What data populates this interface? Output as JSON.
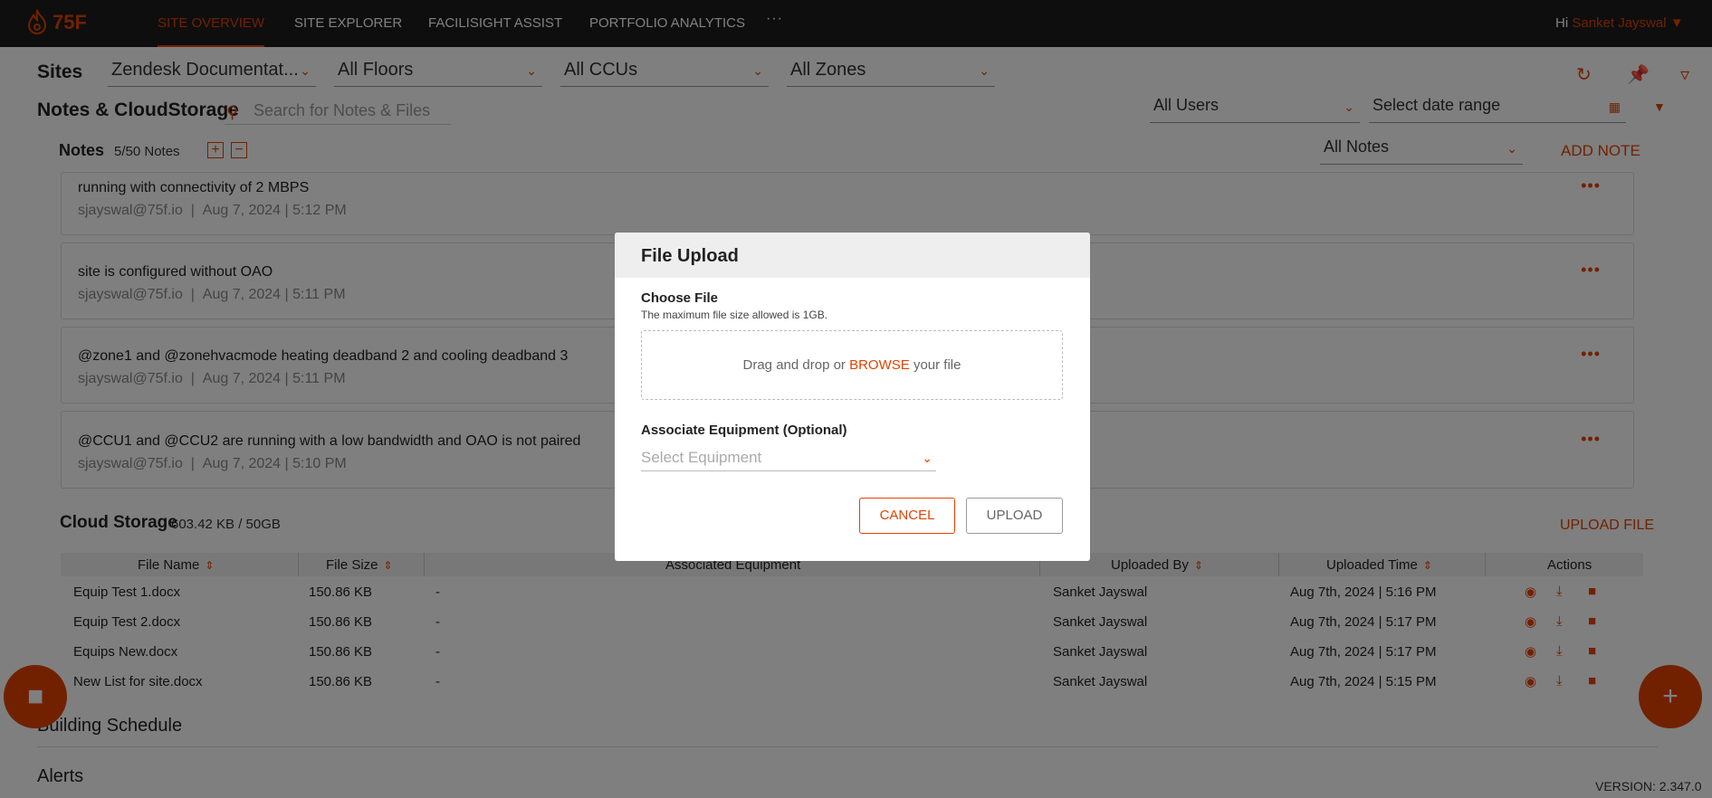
{
  "nav": {
    "brand": "75F",
    "items": [
      "SITE OVERVIEW",
      "SITE EXPLORER",
      "FACILISIGHT ASSIST",
      "PORTFOLIO ANALYTICS"
    ],
    "more": "···",
    "greeting": "Hi",
    "user_name": "Sanket Jayswal"
  },
  "filters": {
    "sites_label": "Sites",
    "site": "Zendesk Documentat...",
    "floors": "All Floors",
    "ccus": "All CCUs",
    "zones": "All Zones"
  },
  "notes_storage": {
    "title": "Notes & CloudStorage",
    "search_placeholder": "Search for Notes & Files",
    "users_filter": "All Users",
    "date_range_placeholder": "Select date range"
  },
  "notes": {
    "label": "Notes",
    "count": "5/50 Notes",
    "filter": "All Notes",
    "add_label": "ADD NOTE",
    "items": [
      {
        "text": "running with connectivity of 2 MBPS",
        "author": "sjayswal@75f.io",
        "time": "Aug 7, 2024 | 5:12 PM"
      },
      {
        "text": "site is configured without OAO",
        "author": "sjayswal@75f.io",
        "time": "Aug 7, 2024 | 5:11 PM"
      },
      {
        "text": "@zone1 and @zonehvacmode heating deadband 2 and cooling deadband 3",
        "author": "sjayswal@75f.io",
        "time": "Aug 7, 2024 | 5:11 PM"
      },
      {
        "text": "@CCU1 and @CCU2 are running with a low bandwidth and OAO is not paired",
        "author": "sjayswal@75f.io",
        "time": "Aug 7, 2024 | 5:10 PM"
      }
    ]
  },
  "cloud": {
    "title": "Cloud Storage",
    "usage": "603.42 KB / 50GB",
    "upload_label": "UPLOAD FILE",
    "columns": [
      "File Name",
      "File Size",
      "Associated Equipment",
      "Uploaded By",
      "Uploaded Time",
      "Actions"
    ],
    "rows": [
      {
        "name": "Equip Test 1.docx",
        "size": "150.86 KB",
        "equipment": "-",
        "by": "Sanket Jayswal",
        "time": "Aug 7th, 2024 | 5:16 PM"
      },
      {
        "name": "Equip Test 2.docx",
        "size": "150.86 KB",
        "equipment": "-",
        "by": "Sanket Jayswal",
        "time": "Aug 7th, 2024 | 5:17 PM"
      },
      {
        "name": "Equips New.docx",
        "size": "150.86 KB",
        "equipment": "-",
        "by": "Sanket Jayswal",
        "time": "Aug 7th, 2024 | 5:17 PM"
      },
      {
        "name": "New List for site.docx",
        "size": "150.86 KB",
        "equipment": "-",
        "by": "Sanket Jayswal",
        "time": "Aug 7th, 2024 | 5:15 PM"
      }
    ]
  },
  "sections": {
    "building_schedule": "Building Schedule",
    "alerts": "Alerts"
  },
  "version": "VERSION: 2.347.0",
  "modal": {
    "title": "File Upload",
    "choose_label": "Choose File",
    "hint": "The maximum file size allowed is 1GB.",
    "drop_text_before": "Drag and drop or",
    "browse": "BROWSE",
    "drop_text_after": "your file",
    "equipment_label": "Associate Equipment (Optional)",
    "equipment_placeholder": "Select Equipment",
    "cancel": "CANCEL",
    "upload": "UPLOAD"
  },
  "colors": {
    "accent": "#e24301",
    "nav_bg": "#1c1c1c",
    "overlay": "rgba(0,0,0,0.5)"
  }
}
